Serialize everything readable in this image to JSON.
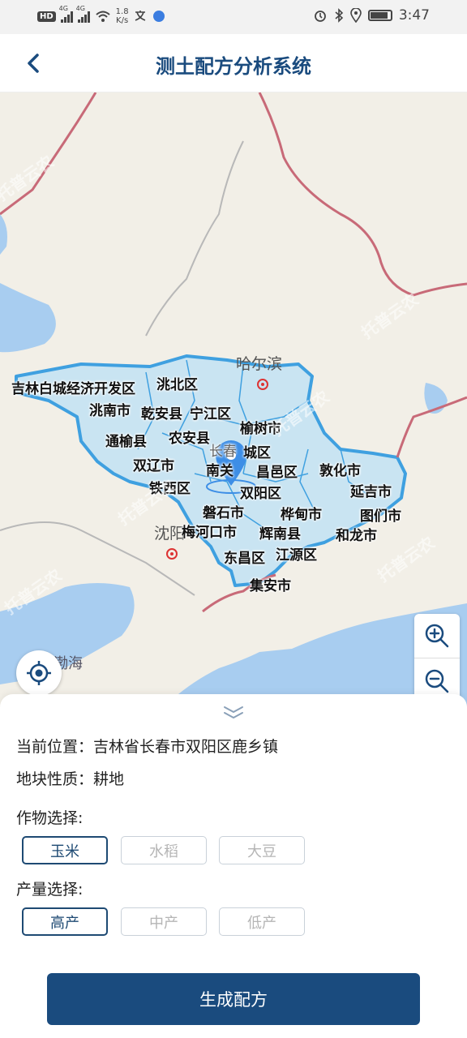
{
  "status_bar": {
    "hd_badge": "HD",
    "sim1_label": "4G",
    "sim2_label": "4G",
    "speed_value": "1.8",
    "speed_unit": "K/s",
    "time": "3:47"
  },
  "header": {
    "title": "测土配方分析系统",
    "back_icon": "chevron-left-icon"
  },
  "map": {
    "cities": [
      "哈尔滨",
      "沈阳"
    ],
    "sea": "渤海",
    "districts": [
      "吉林白城经济开发区",
      "洮北区",
      "洮南市",
      "乾安县",
      "宁江区",
      "通榆县",
      "农安县",
      "榆树市",
      "长春",
      "城区",
      "双辽市",
      "南关",
      "昌邑区",
      "敦化市",
      "铁西区",
      "双阳区",
      "延吉市",
      "磐石市",
      "桦甸市",
      "图们市",
      "梅河口市",
      "辉南县",
      "和龙市",
      "东昌区",
      "江源区",
      "集安市"
    ],
    "watermark": "托普云农",
    "colors": {
      "province_fill": "#c9e4f2",
      "province_border": "#3fa0e0",
      "border_line": "#c86a78",
      "water": "#a8cdf0",
      "land": "#f2efe7",
      "pin": "#3d8ee6"
    }
  },
  "controls": {
    "zoom_in_icon": "zoom-in-icon",
    "zoom_out_icon": "zoom-out-icon",
    "locate_icon": "locate-icon"
  },
  "panel": {
    "collapse_icon": "double-chevron-down-icon",
    "location": "当前位置：吉林省长春市双阳区鹿乡镇",
    "land_type": "地块性质：耕地",
    "crop_label": "作物选择:",
    "crops": [
      "玉米",
      "水稻",
      "大豆"
    ],
    "crop_selected": "玉米",
    "yield_label": "产量选择:",
    "yields": [
      "高产",
      "中产",
      "低产"
    ],
    "yield_selected": "高产",
    "generate_label": "生成配方",
    "accent_color": "#1a4b7e"
  }
}
